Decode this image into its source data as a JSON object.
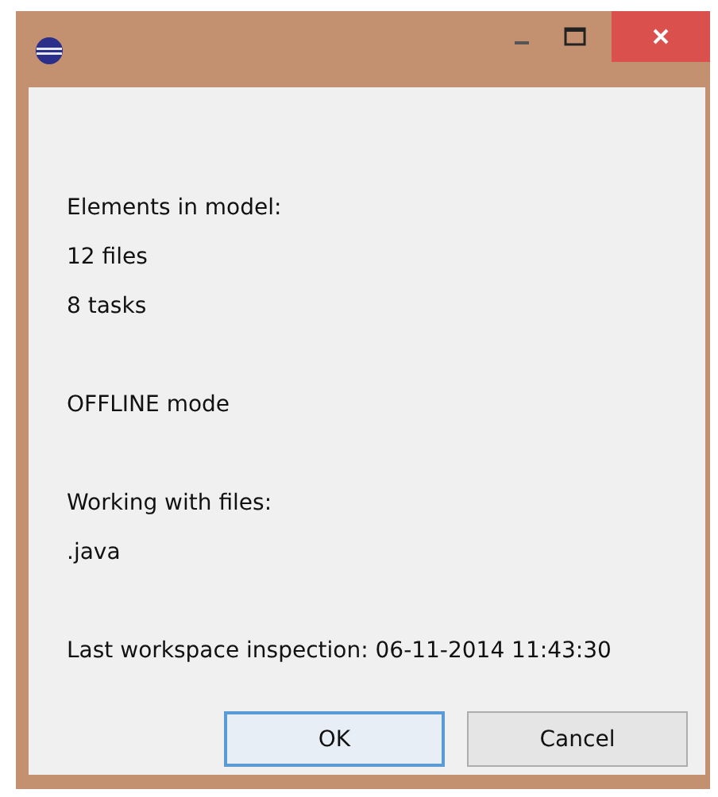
{
  "paragraphs": [
    [
      "Elements in model:",
      "12 files",
      "8 tasks"
    ],
    [
      "OFFLINE mode"
    ],
    [
      "Working with files:",
      ".java"
    ],
    [
      "Last workspace inspection: 06-11-2014 11:43:30"
    ]
  ],
  "buttons": [
    {
      "label": "OK",
      "default": true
    },
    {
      "label": "Cancel",
      "default": false
    }
  ]
}
